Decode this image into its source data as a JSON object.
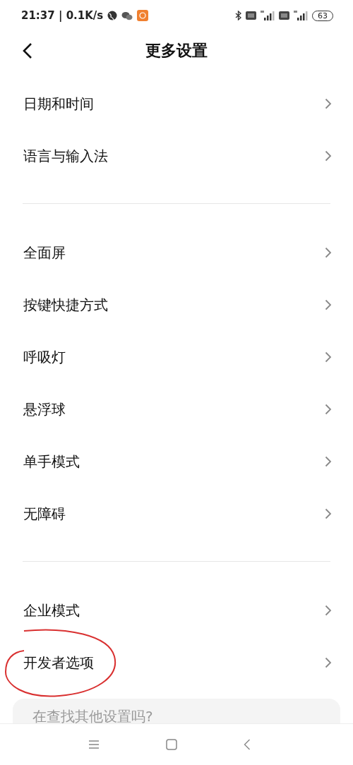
{
  "status_bar": {
    "time": "21:37 | 0.1K/s",
    "battery": "63"
  },
  "header": {
    "title": "更多设置"
  },
  "groups": [
    {
      "items": [
        {
          "label": "日期和时间"
        },
        {
          "label": "语言与输入法"
        }
      ]
    },
    {
      "items": [
        {
          "label": "全面屏"
        },
        {
          "label": "按键快捷方式"
        },
        {
          "label": "呼吸灯"
        },
        {
          "label": "悬浮球"
        },
        {
          "label": "单手模式"
        },
        {
          "label": "无障碍"
        }
      ]
    },
    {
      "items": [
        {
          "label": "企业模式",
          "circled": false
        },
        {
          "label": "开发者选项",
          "circled": true
        }
      ]
    }
  ],
  "suggestion_card": {
    "text": "在查找其他设置吗?"
  }
}
